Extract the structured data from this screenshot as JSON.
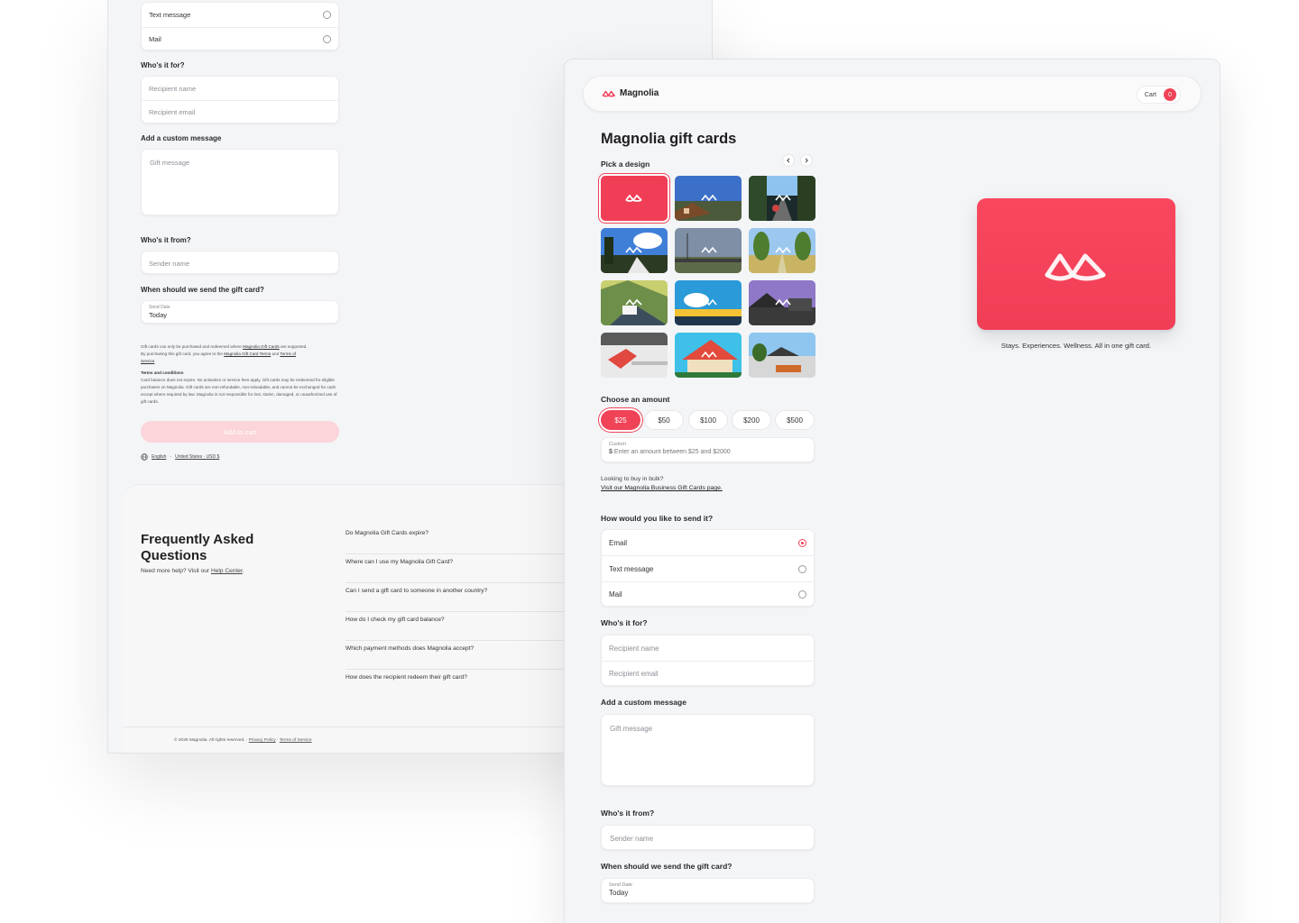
{
  "back": {
    "send_options": [
      "Text message",
      "Mail"
    ],
    "whos_for_label": "Who's it for?",
    "recipient_name_ph": "Recipient name",
    "recipient_email_ph": "Recipient email",
    "custom_message_label": "Add a custom message",
    "gift_message_ph": "Gift message",
    "whos_from_label": "Who's it from?",
    "sender_name_ph": "Sender name",
    "when_label": "When should we send the gift card?",
    "send_date_small": "Send Date",
    "send_date_value": "Today",
    "fine_line1_a": "Gift cards can only be purchased and redeemed where ",
    "fine_line1_link": "Magnolia Gift Cards",
    "fine_line1_b": " are supported.",
    "fine_line2_a": "By purchasing this gift card, you agree to the ",
    "fine_line2_link1": "Magnolia Gift Card Terms",
    "fine_line2_and": " and ",
    "fine_line2_link2": "Terms of",
    "fine_line3_link": "Service",
    "fine_line3_dot": ".",
    "terms_title": "Terms and conditions",
    "terms_body": "Card balance does not expire. No activation or service fees apply. Gift cards may be redeemed for eligible purchases on Magnolia. Gift cards are non-refundable, non-reloadable, and cannot be exchanged for cash except where required by law. Magnolia is not responsible for lost, stolen, damaged, or unauthorized use of gift cards.",
    "add_to_cart": "Add to cart",
    "lang": "English",
    "sep": "·",
    "region": "United States · USD $",
    "faq_title_1": "Frequently Asked",
    "faq_title_2": "Questions",
    "faq_help_a": "Need more help? Visit our ",
    "faq_help_link": "Help Center",
    "faq_help_dot": ".",
    "faq_items": [
      "Do Magnolia Gift Cards expire?",
      "Where can I use my Magnolia Gift Card?",
      "Can I send a gift card to someone in another country?",
      "How do I check my gift card balance?",
      "Which payment methods does Magnolia accept?",
      "How does the recipient redeem their gift card?"
    ],
    "footer_a": "© 2026 Magnolia. All rights reserved. · ",
    "footer_privacy": "Privacy Policy",
    "footer_sep": " · ",
    "footer_terms": "Terms of Service"
  },
  "front": {
    "brand": "Magnolia",
    "cart_label": "Cart",
    "cart_count": "0",
    "page_title": "Magnolia gift cards",
    "pick_design": "Pick a design",
    "choose_amount": "Choose an amount",
    "amounts": [
      "$25",
      "$50",
      "$100",
      "$200",
      "$500"
    ],
    "custom_small": "Custom",
    "custom_currency": "$",
    "custom_ph": "Enter an amount between $25 and $2000",
    "bulk_q": "Looking to buy in bulk?",
    "bulk_link": "Visit our Magnolia Business Gift Cards page.",
    "send_how": "How would you like to send it?",
    "send_options": [
      "Email",
      "Text message",
      "Mail"
    ],
    "selected_option": 0,
    "whos_for_label": "Who's it for?",
    "recipient_name_ph": "Recipient name",
    "recipient_email_ph": "Recipient email",
    "custom_message_label": "Add a custom message",
    "gift_message_ph": "Gift message",
    "whos_from_label": "Who's it from?",
    "sender_name_ph": "Sender name",
    "when_label": "When should we send the gift card?",
    "send_date_small": "Send Date",
    "send_date_value": "Today",
    "tagline": "Stays. Experiences. Wellness. All in one gift card."
  },
  "colors": {
    "accent": "#f04358",
    "background": "#f4f5f7"
  },
  "icons": [
    "magnolia-logo-icon",
    "chevron-left-icon",
    "chevron-right-icon",
    "globe-icon",
    "radio-icon"
  ]
}
